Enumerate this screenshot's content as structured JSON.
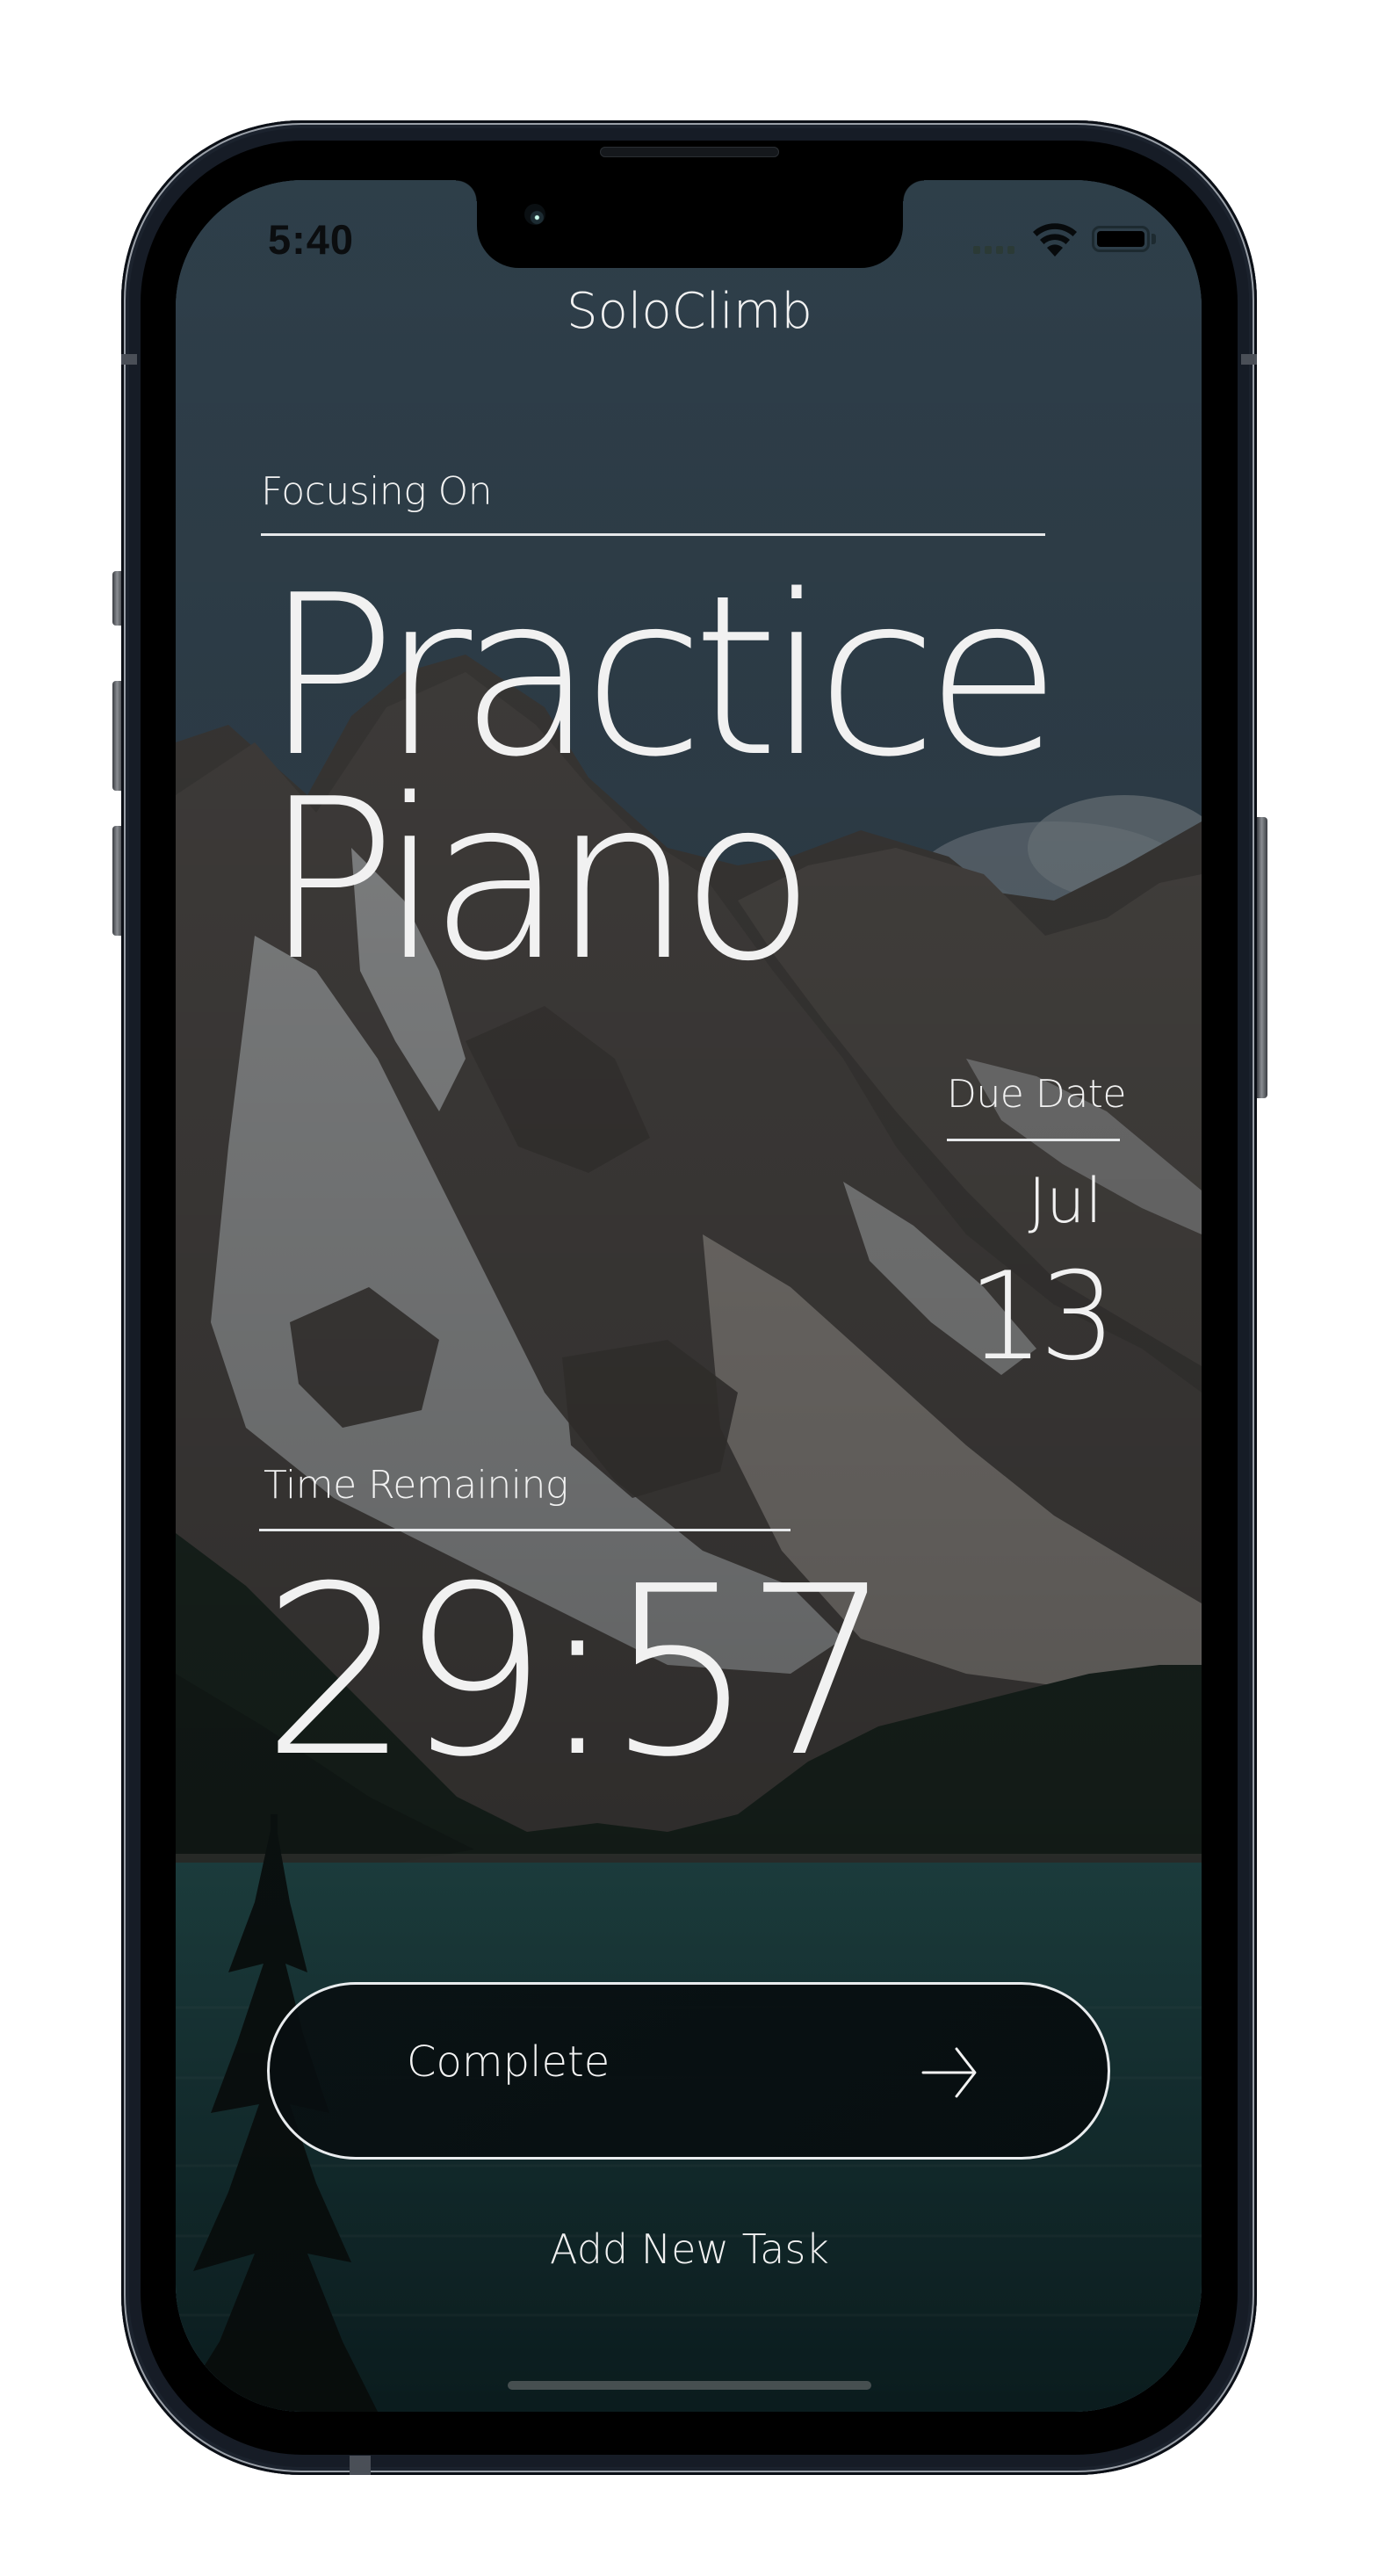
{
  "status_bar": {
    "time": "5:40",
    "icons": [
      "cellular-signal-icon",
      "wifi-icon",
      "battery-icon"
    ]
  },
  "app": {
    "title": "SoloClimb"
  },
  "focus": {
    "label": "Focusing On",
    "task_line1": "Practice",
    "task_line2": "Piano"
  },
  "due_date": {
    "label": "Due Date",
    "month": "Jul",
    "day": "13"
  },
  "timer": {
    "label": "Time Remaining",
    "value": "29:57"
  },
  "actions": {
    "complete_label": "Complete",
    "complete_icon": "arrow-right-icon",
    "add_task_label": "Add New Task"
  },
  "colors": {
    "text": "#f1f1f1",
    "sky": "#3a4f5c",
    "lake": "#1f5a5a",
    "button_bg": "#0a1214",
    "button_border": "#e9ecee"
  }
}
